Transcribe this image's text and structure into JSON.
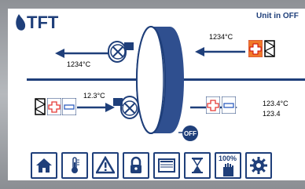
{
  "header": {
    "brand": "TFT",
    "status": "Unit in OFF"
  },
  "temperatures": {
    "exhaust_air": "1234°C",
    "outdoor_air": "1234°C",
    "extract_air": "12.3°C",
    "supply_air": "123.4°C",
    "supply_secondary": "123.4"
  },
  "fan_state": "OFF",
  "navbar": {
    "items": [
      {
        "name": "home",
        "icon": "home-icon"
      },
      {
        "name": "temperature",
        "icon": "thermometer-icon"
      },
      {
        "name": "alarms",
        "icon": "warning-icon"
      },
      {
        "name": "lock",
        "icon": "lock-icon"
      },
      {
        "name": "display",
        "icon": "screen-icon"
      },
      {
        "name": "timer",
        "icon": "hourglass-icon"
      },
      {
        "name": "manual",
        "icon": "hand-icon",
        "label": "100%"
      },
      {
        "name": "settings",
        "icon": "gear-icon"
      }
    ]
  },
  "colors": {
    "primary": "#1f3f7a",
    "heater": "#e53935",
    "cooler": "#2f5fc0",
    "frame": "#9a9da1"
  }
}
